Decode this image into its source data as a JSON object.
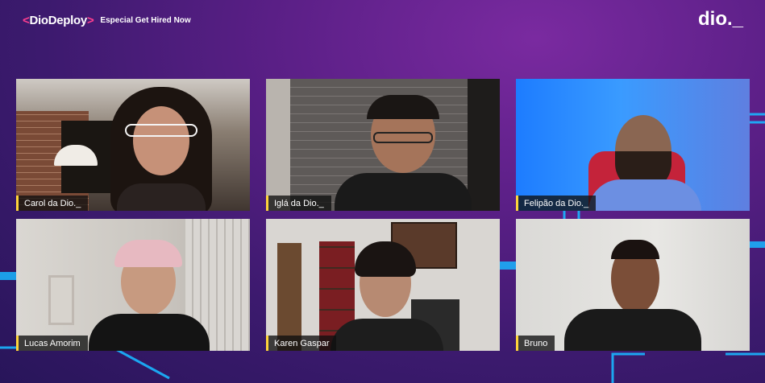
{
  "header": {
    "brand_prefix": "<",
    "brand_name": "DioDeploy",
    "brand_suffix": ">",
    "event_title": "Especial Get Hired Now",
    "logo_text": "dio._"
  },
  "participants": [
    {
      "name": "Carol da Dio._"
    },
    {
      "name": "Iglá da Dio._"
    },
    {
      "name": "Felipão da Dio._"
    },
    {
      "name": "Lucas Amorim"
    },
    {
      "name": "Karen Gaspar"
    },
    {
      "name": "Bruno"
    }
  ],
  "colors": {
    "accent_pink": "#ff3f8f",
    "name_tag_border": "#ffd43b",
    "circuit_cyan": "#19b6ff"
  }
}
